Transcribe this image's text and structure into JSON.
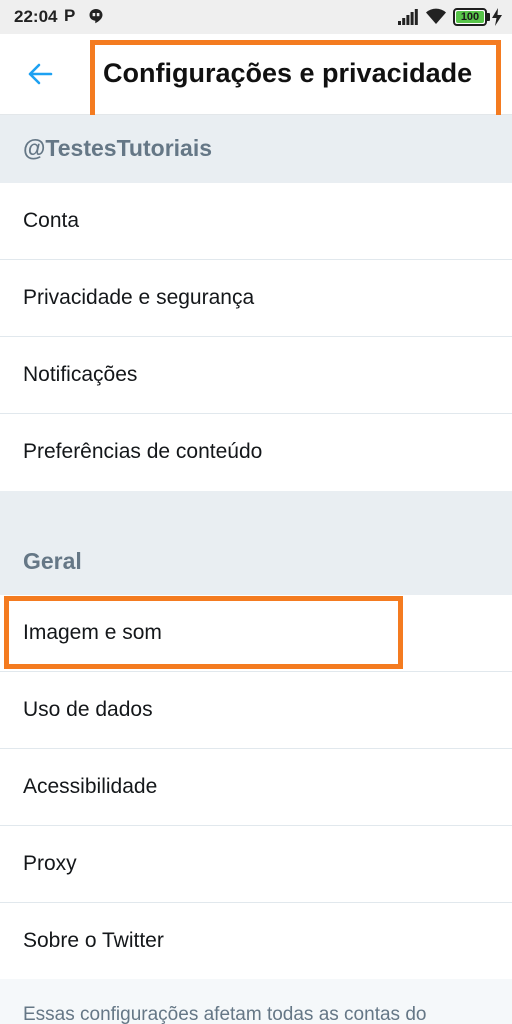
{
  "status_bar": {
    "time": "22:04",
    "p_glyph": "P",
    "battery_level": "100",
    "battery_fraction": 1.0,
    "icons": [
      "hangouts-icon",
      "signal-icon",
      "wifi-icon",
      "battery-icon",
      "charging-icon"
    ]
  },
  "header": {
    "back_icon": "arrow-left-icon",
    "title": "Configurações e privacidade",
    "accent_color": "#1da1f2"
  },
  "annotation": {
    "highlight_color": "#f47b20"
  },
  "sections": [
    {
      "label": "@TestesTutoriais",
      "items": [
        {
          "label": "Conta"
        },
        {
          "label": "Privacidade e segurança"
        },
        {
          "label": "Notificações"
        },
        {
          "label": "Preferências de conteúdo"
        }
      ]
    },
    {
      "label": "Geral",
      "items": [
        {
          "label": "Imagem e som"
        },
        {
          "label": "Uso de dados"
        },
        {
          "label": "Acessibilidade"
        },
        {
          "label": "Proxy"
        },
        {
          "label": "Sobre o Twitter"
        }
      ]
    }
  ],
  "footer": {
    "note": "Essas configurações afetam todas as contas do"
  }
}
